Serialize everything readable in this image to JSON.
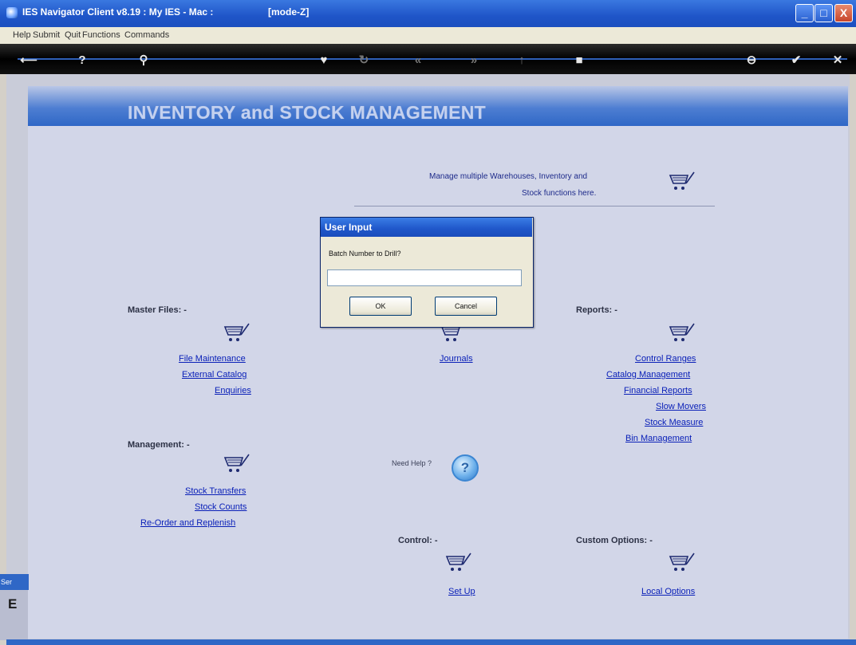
{
  "window": {
    "title": "IES Navigator Client v8.19 : My IES - Mac :",
    "mode": "[mode-Z]",
    "min_label": "_",
    "max_label": "□",
    "close_label": "X"
  },
  "menu": {
    "items": [
      "Help",
      "Submit",
      "Quit",
      "Functions",
      "Commands"
    ]
  },
  "toolbar": {
    "icons": [
      "back-arrow-icon",
      "help-icon",
      "search-icon",
      "heart-icon",
      "refresh-icon",
      "rewind-icon",
      "fast-forward-icon",
      "up-icon",
      "stop-icon",
      "minus-icon",
      "check-icon",
      "close-icon"
    ]
  },
  "banner": {
    "title": "INVENTORY and STOCK MANAGEMENT"
  },
  "intro": {
    "line1": "Manage multiple Warehouses, Inventory and",
    "line2": "Stock functions here."
  },
  "sections": {
    "master_files": {
      "title": "Master Files: -",
      "links": [
        "File Maintenance",
        "External Catalog",
        "Enquiries"
      ]
    },
    "transactions": {
      "links": [
        "Journals"
      ]
    },
    "reports": {
      "title": "Reports: -",
      "links": [
        "Control Ranges",
        "Catalog Management",
        "Financial Reports",
        "Slow Movers",
        "Stock Measure",
        "Bin Management"
      ]
    },
    "management": {
      "title": "Management: -",
      "links": [
        "Stock Transfers",
        "Stock Counts",
        "Re-Order and Replenish"
      ]
    },
    "control": {
      "title": "Control: -",
      "links": [
        "Set Up"
      ]
    },
    "custom": {
      "title": "Custom Options: -",
      "links": [
        "Local Options"
      ]
    }
  },
  "help": {
    "text": "Need Help ?",
    "icon": "?"
  },
  "side_tab": {
    "label": "Ser",
    "glyph": "E"
  },
  "dialog": {
    "title": "User Input",
    "prompt": "Batch Number to Drill?",
    "input_value": "",
    "ok_label": "OK",
    "cancel_label": "Cancel"
  }
}
